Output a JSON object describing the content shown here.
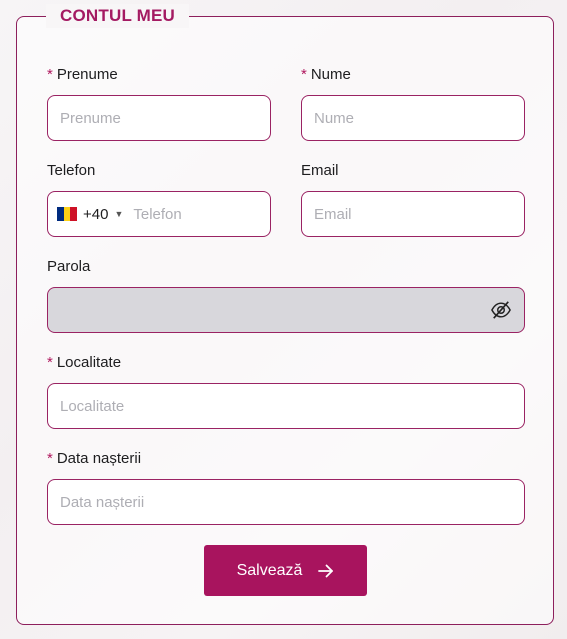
{
  "form": {
    "title": "CONTUL MEU",
    "required_mark": "*",
    "fields": {
      "first_name": {
        "label": "Prenume",
        "placeholder": "Prenume",
        "required": true
      },
      "last_name": {
        "label": "Nume",
        "placeholder": "Nume",
        "required": true
      },
      "phone": {
        "label": "Telefon",
        "placeholder": "Telefon",
        "country_code": "+40",
        "flag_colors": [
          "#002b7f",
          "#fcd116",
          "#ce1126"
        ]
      },
      "email": {
        "label": "Email",
        "placeholder": "Email"
      },
      "password": {
        "label": "Parola",
        "placeholder": ""
      },
      "city": {
        "label": "Localitate",
        "placeholder": "Localitate",
        "required": true
      },
      "birthdate": {
        "label": "Data nașterii",
        "placeholder": "Data nașterii",
        "required": true
      }
    },
    "save_label": "Salvează"
  },
  "colors": {
    "accent": "#a8145e",
    "border": "#9a2363",
    "disabled_bg": "#d8d7dc"
  }
}
